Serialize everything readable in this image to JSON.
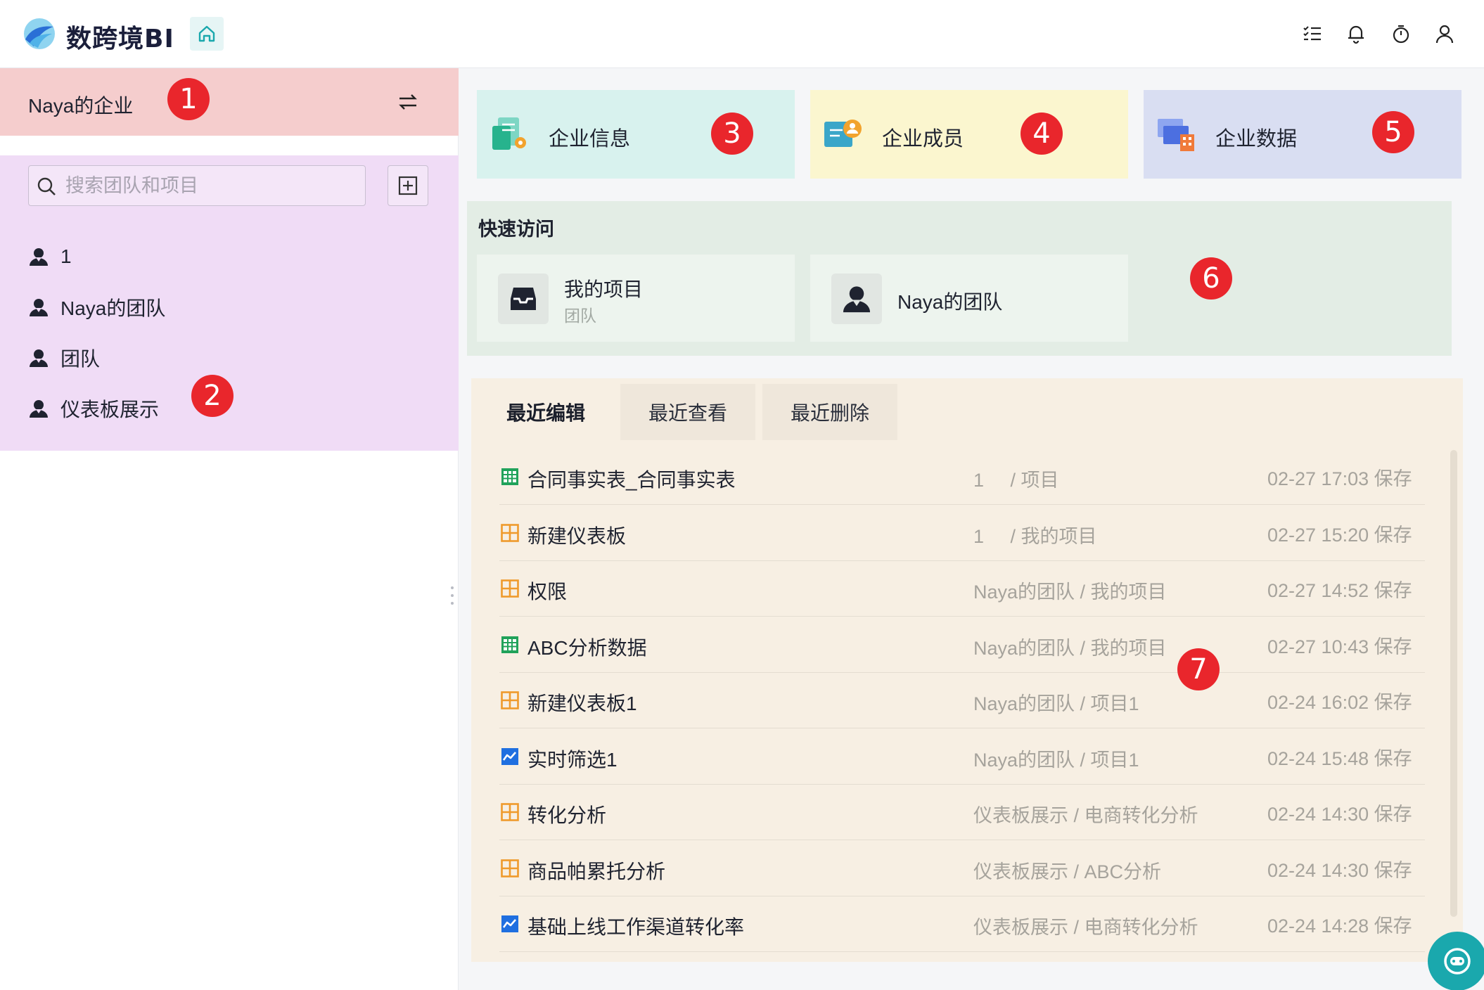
{
  "app": {
    "brand": "数跨境BI"
  },
  "enterprise": {
    "name": "Naya的企业"
  },
  "search": {
    "placeholder": "搜索团队和项目"
  },
  "teams": [
    {
      "label": "1"
    },
    {
      "label": "Naya的团队"
    },
    {
      "label": "团队"
    },
    {
      "label": "仪表板展示"
    }
  ],
  "cards": [
    {
      "label": "企业信息"
    },
    {
      "label": "企业成员"
    },
    {
      "label": "企业数据"
    }
  ],
  "quick_access": {
    "title": "快速访问",
    "items": [
      {
        "name": "我的项目",
        "sub": "团队"
      },
      {
        "name": "Naya的团队"
      }
    ]
  },
  "recent": {
    "tabs": [
      "最近编辑",
      "最近查看",
      "最近删除"
    ],
    "rows": [
      {
        "icon": "table-icon",
        "name": "合同事实表_合同事实表",
        "path": "1     / 项目",
        "time": "02-27 17:03 保存"
      },
      {
        "icon": "dashboard-icon",
        "name": "新建仪表板",
        "path": "1     / 我的项目",
        "time": "02-27 15:20 保存"
      },
      {
        "icon": "dashboard-icon",
        "name": "权限",
        "path": "Naya的团队 / 我的项目",
        "time": "02-27 14:52 保存"
      },
      {
        "icon": "table-icon",
        "name": "ABC分析数据",
        "path": "Naya的团队 / 我的项目",
        "time": "02-27 10:43 保存"
      },
      {
        "icon": "dashboard-icon",
        "name": "新建仪表板1",
        "path": "Naya的团队 / 项目1",
        "time": "02-24 16:02 保存"
      },
      {
        "icon": "chart-icon",
        "name": "实时筛选1",
        "path": "Naya的团队 / 项目1",
        "time": "02-24 15:48 保存"
      },
      {
        "icon": "dashboard-icon",
        "name": "转化分析",
        "path": "仪表板展示 / 电商转化分析",
        "time": "02-24 14:30 保存"
      },
      {
        "icon": "dashboard-icon",
        "name": "商品帕累托分析",
        "path": "仪表板展示 / ABC分析",
        "time": "02-24 14:30 保存"
      },
      {
        "icon": "chart-icon",
        "name": "基础上线工作渠道转化率",
        "path": "仪表板展示 / 电商转化分析",
        "time": "02-24 14:28 保存"
      }
    ]
  },
  "badges": [
    "1",
    "2",
    "3",
    "4",
    "5",
    "6",
    "7"
  ],
  "colors": {
    "accent": "#1aa8ad",
    "badge": "#e9262c",
    "enterprise_bg": "#f5cdcd",
    "team_panel_bg": "#f0dcf6",
    "card_info_bg": "#d8f2ee",
    "card_members_bg": "#fbf6cf",
    "card_data_bg": "#d9def2",
    "quick_bg": "#e3ede5",
    "recent_bg": "#f7efe3"
  }
}
